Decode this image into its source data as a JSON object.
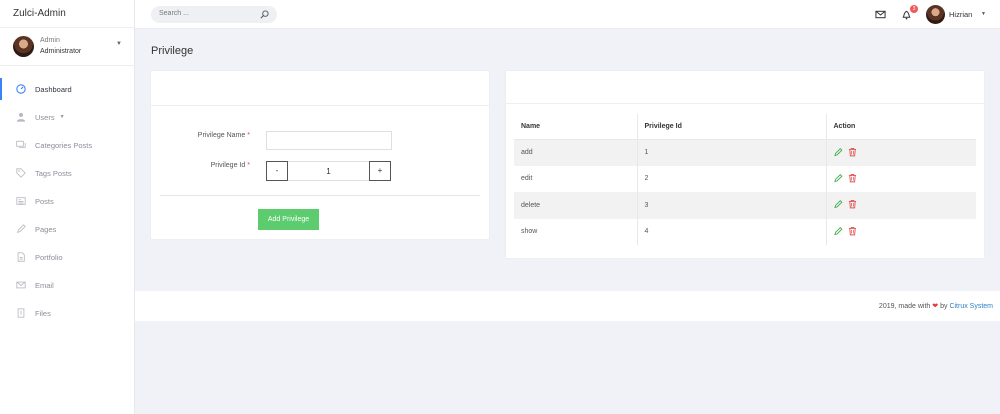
{
  "sidebar": {
    "brand": "Zulci-Admin",
    "profile": {
      "name": "Admin",
      "role": "Administrator"
    },
    "items": [
      {
        "label": "Dashboard",
        "icon": "dashboard-icon"
      },
      {
        "label": "Users",
        "icon": "user-icon"
      },
      {
        "label": "Categories Posts",
        "icon": "chat-icon"
      },
      {
        "label": "Tags Posts",
        "icon": "tag-icon"
      },
      {
        "label": "Posts",
        "icon": "newspaper-icon"
      },
      {
        "label": "Pages",
        "icon": "pencil-icon"
      },
      {
        "label": "Portfolio",
        "icon": "document-icon"
      },
      {
        "label": "Email",
        "icon": "envelope-icon"
      },
      {
        "label": "Files",
        "icon": "file-icon"
      }
    ]
  },
  "topbar": {
    "search_placeholder": "Search ...",
    "notification_count": "3",
    "user_name": "Hizrian"
  },
  "page": {
    "title": "Privilege"
  },
  "form": {
    "name_label": "Privilege Name",
    "id_label": "Privilege Id",
    "required_mark": "*",
    "name_value": "",
    "decrement_label": "-",
    "increment_label": "+",
    "id_value": "1",
    "submit_label": "Add Privilege"
  },
  "table": {
    "headers": [
      "Name",
      "Privilege Id",
      "Action"
    ],
    "rows": [
      {
        "name": "add",
        "id": "1"
      },
      {
        "name": "edit",
        "id": "2"
      },
      {
        "name": "delete",
        "id": "3"
      },
      {
        "name": "show",
        "id": "4"
      }
    ]
  },
  "footer": {
    "prefix": "2019, made with",
    "heart": "❤",
    "by": "by",
    "company": "Citrux System"
  },
  "colors": {
    "accent": "#3b82f6",
    "success": "#5ccc6e",
    "danger": "#ef5b5b",
    "edit_icon": "#3fae4a",
    "delete_icon": "#e05252"
  }
}
